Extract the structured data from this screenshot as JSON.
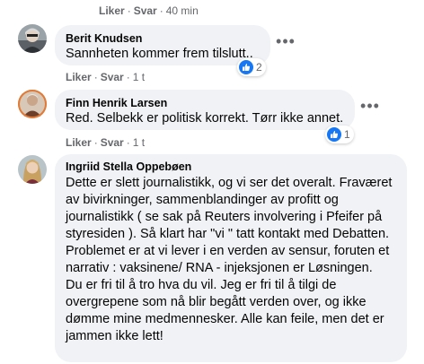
{
  "top_actions": {
    "like": "Liker",
    "reply": "Svar",
    "time": "40 min"
  },
  "comments": [
    {
      "author": "Berit Knudsen",
      "text": "Sannheten kommer frem tilslutt..",
      "like_label": "Liker",
      "reply_label": "Svar",
      "time": "1 t",
      "reactions": "2"
    },
    {
      "author": "Finn Henrik Larsen",
      "text": "Red. Selbekk er politisk korrekt. Tørr ikke annet.",
      "like_label": "Liker",
      "reply_label": "Svar",
      "time": "1 t",
      "reactions": "1"
    },
    {
      "author": "Ingriid Stella Oppebøen",
      "text_lines": [
        "Dette er slett journalistikk, og vi ser det overalt. Fraværet",
        "av bivirkninger, sammenblandinger av profitt og",
        "journalistikk ( se sak på Reuters involvering i Pfeifer på",
        "styresiden ). Så klart har \"vi \" tatt kontakt med Debatten.",
        "Problemet er at vi lever i en verden av sensur, foruten et",
        "narrativ : vaksinene/ RNA - injeksjonen er Løsningen.",
        "Du er fri til å tro hva du vil. Jeg er fri til å tilgi de",
        "overgrepene som nå blir begått verden over, og ikke",
        "dømme mine medmennesker. Alle kan feile, men det er",
        "jammen ikke lett!"
      ]
    }
  ],
  "colors": {
    "bubble_bg": "#f0f2f5",
    "meta_text": "#65676b",
    "like_blue": "#1877f2"
  },
  "icons": {
    "more": "more-options-icon",
    "like": "thumbs-up-icon"
  }
}
